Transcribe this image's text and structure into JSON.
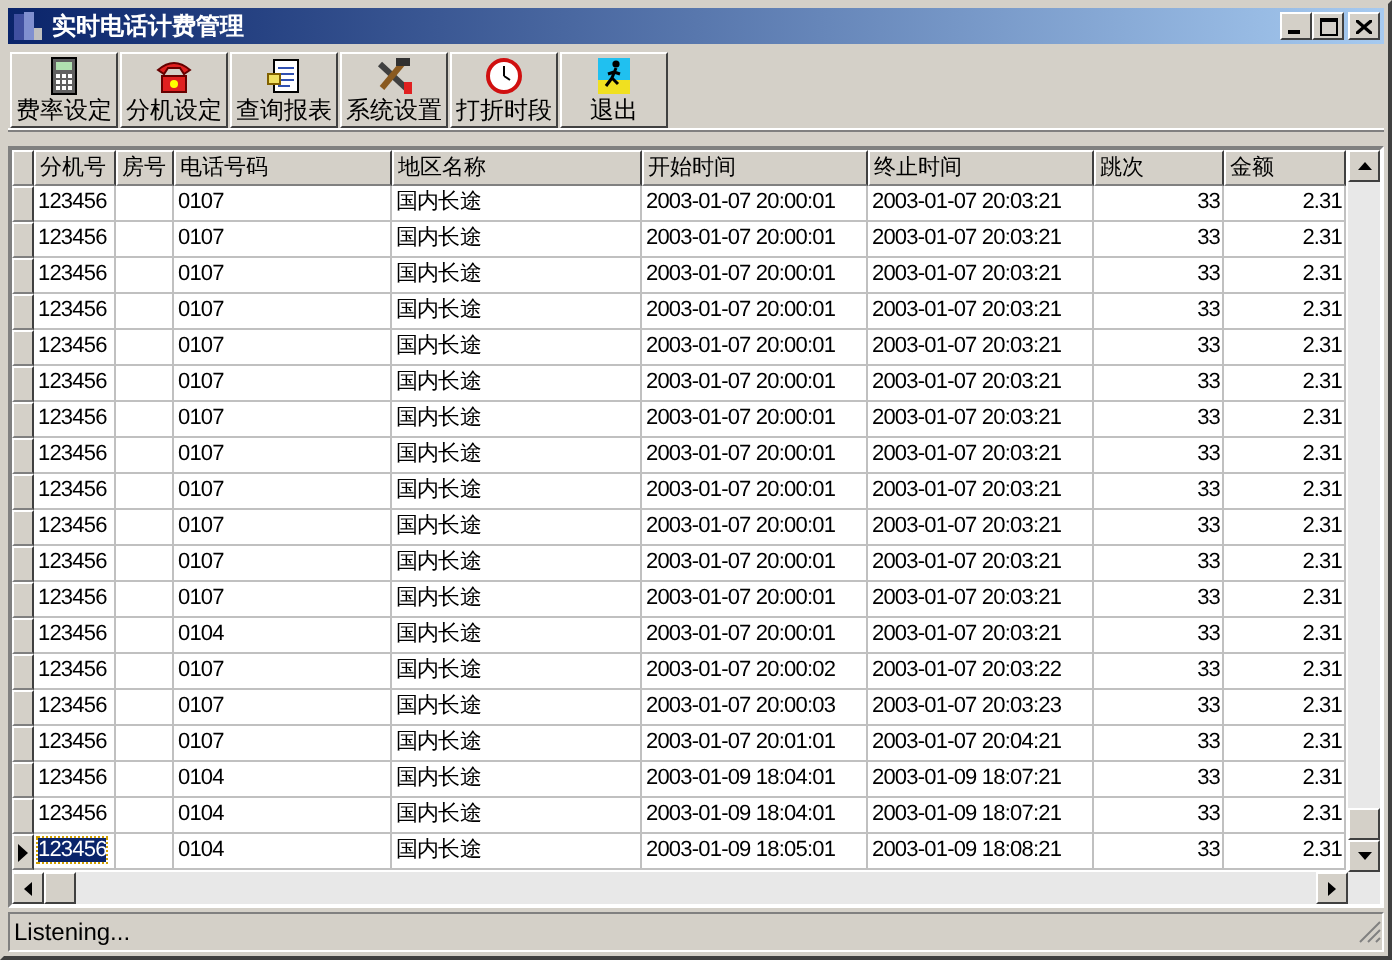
{
  "window": {
    "title": "实时电话计费管理"
  },
  "toolbar": [
    {
      "kind": "calculator",
      "label": "费率设定"
    },
    {
      "kind": "phone",
      "label": "分机设定"
    },
    {
      "kind": "report",
      "label": "查询报表"
    },
    {
      "kind": "tools",
      "label": "系统设置"
    },
    {
      "kind": "clock",
      "label": "打折时段"
    },
    {
      "kind": "exit",
      "label": "退出"
    }
  ],
  "table": {
    "columns": [
      "分机号",
      "房号",
      "电话号码",
      "地区名称",
      "开始时间",
      "终止时间",
      "跳次",
      "金额"
    ],
    "rows": [
      {
        "selected": false,
        "cells": [
          "123456",
          "",
          "0107",
          "国内长途",
          "2003-01-07 20:00:01",
          "2003-01-07 20:03:21",
          "33",
          "2.31"
        ]
      },
      {
        "selected": false,
        "cells": [
          "123456",
          "",
          "0107",
          "国内长途",
          "2003-01-07 20:00:01",
          "2003-01-07 20:03:21",
          "33",
          "2.31"
        ]
      },
      {
        "selected": false,
        "cells": [
          "123456",
          "",
          "0107",
          "国内长途",
          "2003-01-07 20:00:01",
          "2003-01-07 20:03:21",
          "33",
          "2.31"
        ]
      },
      {
        "selected": false,
        "cells": [
          "123456",
          "",
          "0107",
          "国内长途",
          "2003-01-07 20:00:01",
          "2003-01-07 20:03:21",
          "33",
          "2.31"
        ]
      },
      {
        "selected": false,
        "cells": [
          "123456",
          "",
          "0107",
          "国内长途",
          "2003-01-07 20:00:01",
          "2003-01-07 20:03:21",
          "33",
          "2.31"
        ]
      },
      {
        "selected": false,
        "cells": [
          "123456",
          "",
          "0107",
          "国内长途",
          "2003-01-07 20:00:01",
          "2003-01-07 20:03:21",
          "33",
          "2.31"
        ]
      },
      {
        "selected": false,
        "cells": [
          "123456",
          "",
          "0107",
          "国内长途",
          "2003-01-07 20:00:01",
          "2003-01-07 20:03:21",
          "33",
          "2.31"
        ]
      },
      {
        "selected": false,
        "cells": [
          "123456",
          "",
          "0107",
          "国内长途",
          "2003-01-07 20:00:01",
          "2003-01-07 20:03:21",
          "33",
          "2.31"
        ]
      },
      {
        "selected": false,
        "cells": [
          "123456",
          "",
          "0107",
          "国内长途",
          "2003-01-07 20:00:01",
          "2003-01-07 20:03:21",
          "33",
          "2.31"
        ]
      },
      {
        "selected": false,
        "cells": [
          "123456",
          "",
          "0107",
          "国内长途",
          "2003-01-07 20:00:01",
          "2003-01-07 20:03:21",
          "33",
          "2.31"
        ]
      },
      {
        "selected": false,
        "cells": [
          "123456",
          "",
          "0107",
          "国内长途",
          "2003-01-07 20:00:01",
          "2003-01-07 20:03:21",
          "33",
          "2.31"
        ]
      },
      {
        "selected": false,
        "cells": [
          "123456",
          "",
          "0107",
          "国内长途",
          "2003-01-07 20:00:01",
          "2003-01-07 20:03:21",
          "33",
          "2.31"
        ]
      },
      {
        "selected": false,
        "cells": [
          "123456",
          "",
          "0104",
          "国内长途",
          "2003-01-07 20:00:01",
          "2003-01-07 20:03:21",
          "33",
          "2.31"
        ]
      },
      {
        "selected": false,
        "cells": [
          "123456",
          "",
          "0107",
          "国内长途",
          "2003-01-07 20:00:02",
          "2003-01-07 20:03:22",
          "33",
          "2.31"
        ]
      },
      {
        "selected": false,
        "cells": [
          "123456",
          "",
          "0107",
          "国内长途",
          "2003-01-07 20:00:03",
          "2003-01-07 20:03:23",
          "33",
          "2.31"
        ]
      },
      {
        "selected": false,
        "cells": [
          "123456",
          "",
          "0107",
          "国内长途",
          "2003-01-07 20:01:01",
          "2003-01-07 20:04:21",
          "33",
          "2.31"
        ]
      },
      {
        "selected": false,
        "cells": [
          "123456",
          "",
          "0104",
          "国内长途",
          "2003-01-09 18:04:01",
          "2003-01-09 18:07:21",
          "33",
          "2.31"
        ]
      },
      {
        "selected": false,
        "cells": [
          "123456",
          "",
          "0104",
          "国内长途",
          "2003-01-09 18:04:01",
          "2003-01-09 18:07:21",
          "33",
          "2.31"
        ]
      },
      {
        "selected": true,
        "cells": [
          "123456",
          "",
          "0104",
          "国内长途",
          "2003-01-09 18:05:01",
          "2003-01-09 18:08:21",
          "33",
          "2.31"
        ]
      }
    ]
  },
  "status_bar": "Listening..."
}
